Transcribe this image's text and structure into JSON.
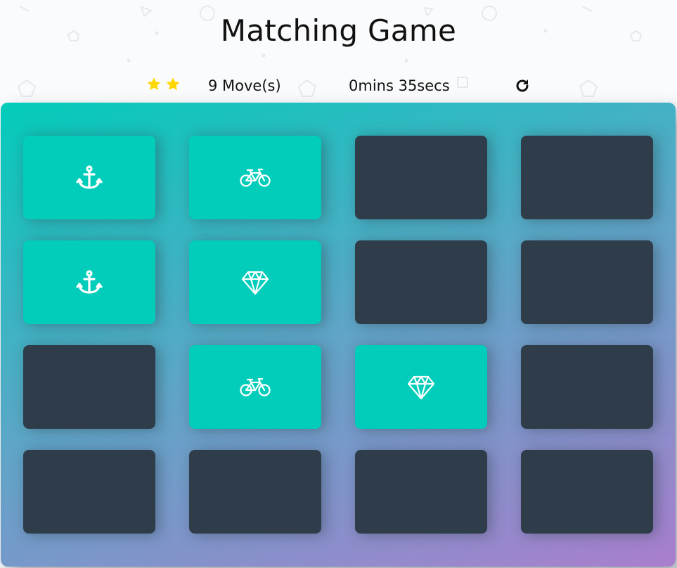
{
  "title": "Matching Game",
  "score_panel": {
    "stars_filled": 2,
    "moves_text": "9 Move(s)",
    "timer_text": "0mins 35secs",
    "restart_icon": "restart-icon"
  },
  "colors": {
    "card_back": "#2e3d49",
    "card_open": "#02ccba",
    "star": "#ffd700",
    "deck_gradient_start": "#02ccba",
    "deck_gradient_end": "#aa7ecd"
  },
  "deck": {
    "rows": 4,
    "columns": 4,
    "cards": [
      {
        "state": "open",
        "icon": "anchor"
      },
      {
        "state": "open",
        "icon": "bicycle"
      },
      {
        "state": "closed",
        "icon": ""
      },
      {
        "state": "closed",
        "icon": ""
      },
      {
        "state": "open",
        "icon": "anchor"
      },
      {
        "state": "open",
        "icon": "diamond"
      },
      {
        "state": "closed",
        "icon": ""
      },
      {
        "state": "closed",
        "icon": ""
      },
      {
        "state": "closed",
        "icon": ""
      },
      {
        "state": "open",
        "icon": "bicycle"
      },
      {
        "state": "open",
        "icon": "diamond"
      },
      {
        "state": "closed",
        "icon": ""
      },
      {
        "state": "closed",
        "icon": ""
      },
      {
        "state": "closed",
        "icon": ""
      },
      {
        "state": "closed",
        "icon": ""
      },
      {
        "state": "closed",
        "icon": ""
      }
    ]
  }
}
